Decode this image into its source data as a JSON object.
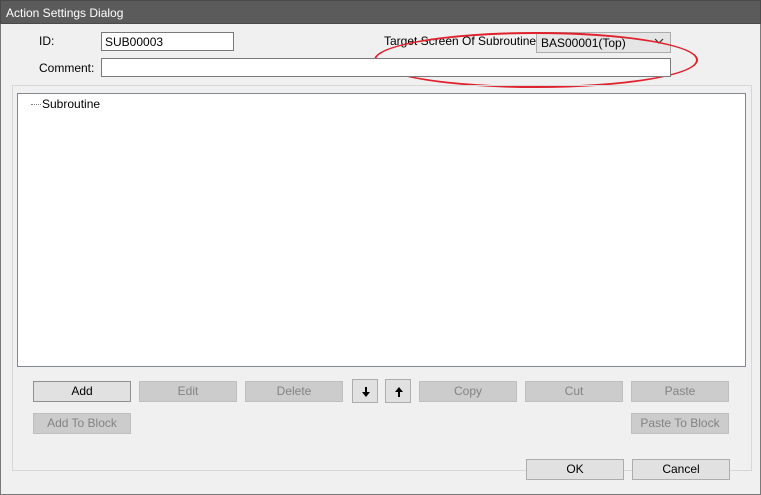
{
  "window": {
    "title": "Action Settings Dialog"
  },
  "form": {
    "id_label": "ID:",
    "id_value": "SUB00003",
    "comment_label": "Comment:",
    "comment_value": "",
    "target_label": "Target Screen Of Subroutine",
    "target_value": "BAS00001(Top)"
  },
  "tree": {
    "root": "Subroutine"
  },
  "toolbar": {
    "add": "Add",
    "edit": "Edit",
    "delete": "Delete",
    "copy": "Copy",
    "cut": "Cut",
    "paste": "Paste",
    "add_to_block": "Add To Block",
    "paste_to_block": "Paste To Block",
    "move_down_icon": "arrow-down-icon",
    "move_up_icon": "arrow-up-icon"
  },
  "footer": {
    "ok": "OK",
    "cancel": "Cancel"
  },
  "colors": {
    "highlight": "#e0202c",
    "titlebar": "#5b5b5b",
    "disabled_text": "#838383"
  }
}
